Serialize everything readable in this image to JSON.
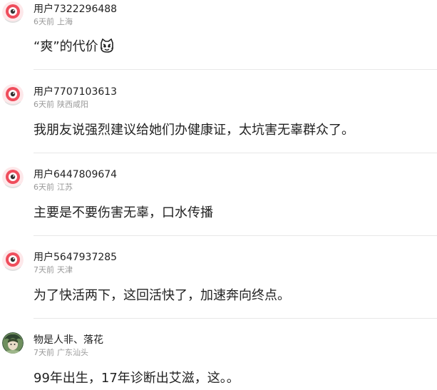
{
  "comments": [
    {
      "username": "用户7322296488",
      "time": "6天前",
      "location": "上海",
      "content": "“爽”的代价",
      "emoji": "cat-face-emoji"
    },
    {
      "username": "用户7707103613",
      "time": "6天前",
      "location": "陕西咸阳",
      "content": "我朋友说强烈建议给她们办健康证，太坑害无辜群众了。"
    },
    {
      "username": "用户6447809674",
      "time": "6天前",
      "location": "江苏",
      "content": "主要是不要伤害无辜，口水传播"
    },
    {
      "username": "用户5647937285",
      "time": "7天前",
      "location": "天津",
      "content": "为了快活两下，这回活快了，加速奔向终点。"
    },
    {
      "username": "物是人非、落花",
      "time": "7天前",
      "location": "广东汕头",
      "content": "99年出生，17年诊断出艾滋，这。。"
    }
  ],
  "colors": {
    "username": "#222222",
    "meta": "#999999",
    "divider": "#e8e8e8",
    "default_avatar": "#ef4d5c"
  }
}
